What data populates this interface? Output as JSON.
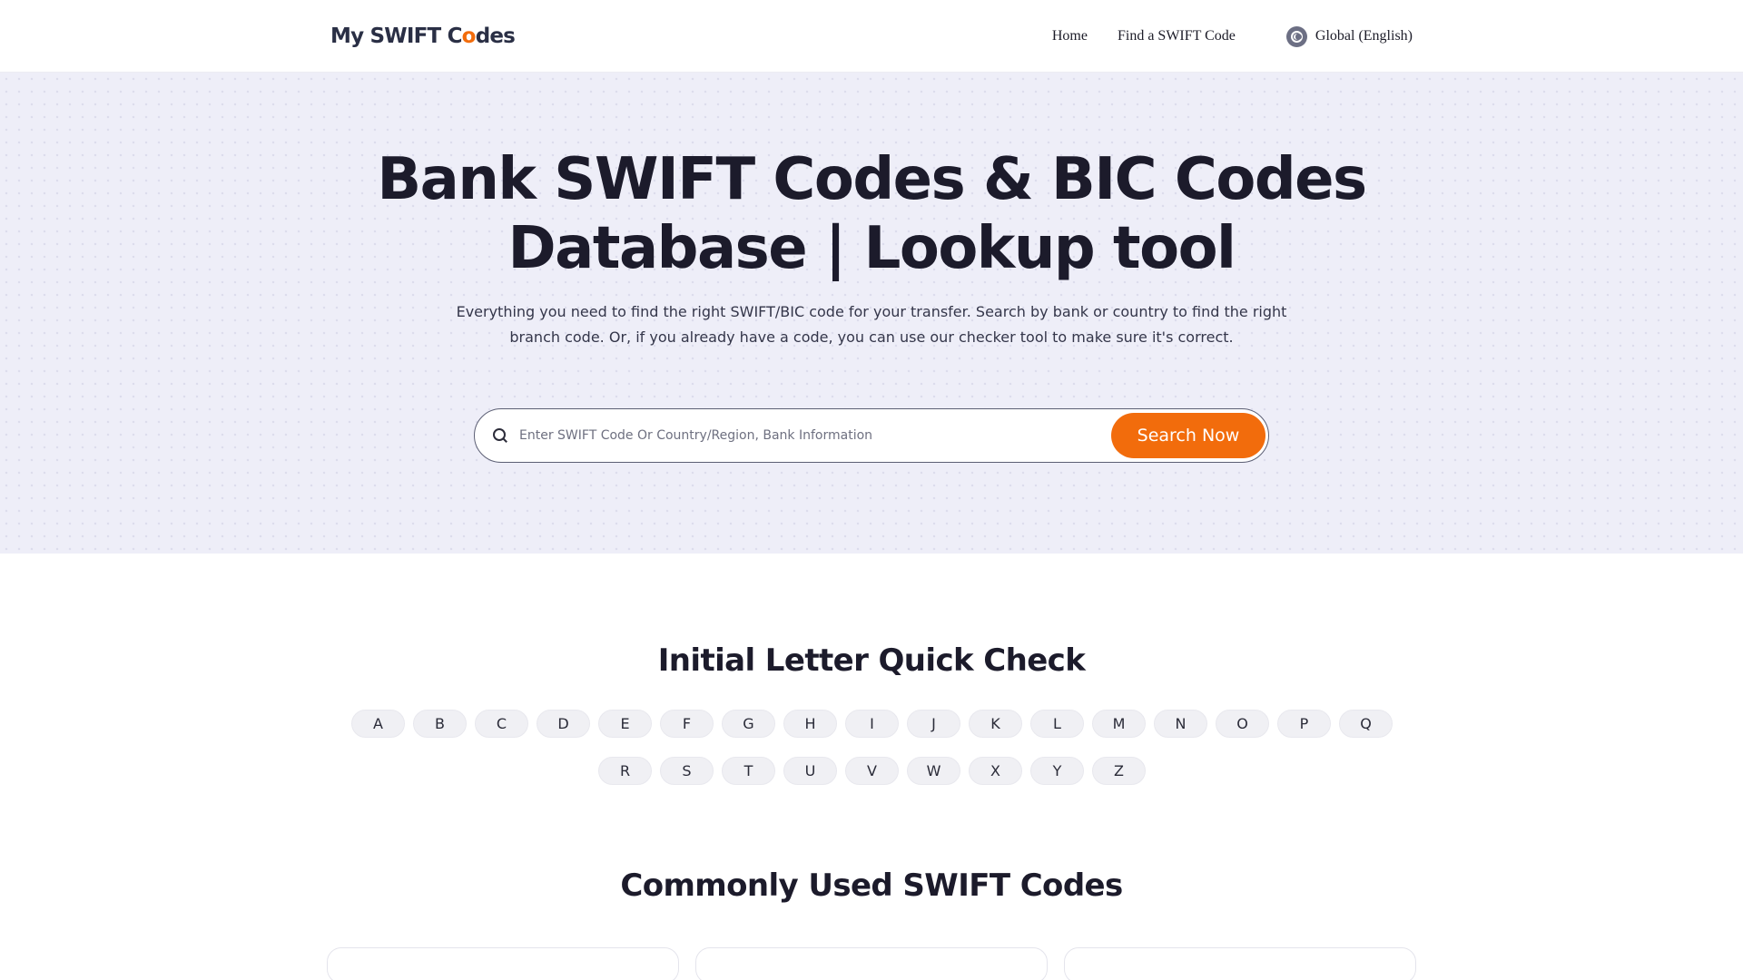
{
  "header": {
    "logo_prefix": "My SWIFT C",
    "logo_accent": "o",
    "logo_suffix": "des",
    "nav": {
      "home": "Home",
      "find": "Find a SWIFT Code",
      "language": "Global (English)"
    }
  },
  "hero": {
    "title_line1": "Bank SWIFT Codes & BIC Codes",
    "title_line2": "Database | Lookup tool",
    "description": "Everything you need to find the right SWIFT/BIC code for your transfer. Search by bank or country to find the right branch code. Or, if you already have a code, you can use our checker tool to make sure it's correct.",
    "search_placeholder": "Enter SWIFT Code Or Country/Region, Bank Information",
    "search_value": "",
    "search_button": "Search Now"
  },
  "quick_check": {
    "title": "Initial Letter Quick Check",
    "letters": [
      "A",
      "B",
      "C",
      "D",
      "E",
      "F",
      "G",
      "H",
      "I",
      "J",
      "K",
      "L",
      "M",
      "N",
      "O",
      "P",
      "Q",
      "R",
      "S",
      "T",
      "U",
      "V",
      "W",
      "X",
      "Y",
      "Z"
    ]
  },
  "common_codes": {
    "title": "Commonly Used SWIFT Codes"
  },
  "colors": {
    "accent": "#f26c0c",
    "hero_background": "#eeeef8",
    "text_dark": "#1c1b2b"
  },
  "icons": {
    "language": "globe-icon",
    "search": "search-icon"
  }
}
